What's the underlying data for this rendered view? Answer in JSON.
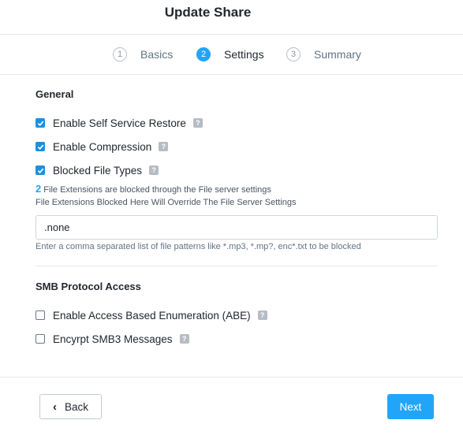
{
  "dialog": {
    "title": "Update Share"
  },
  "steps": [
    {
      "number": "1",
      "label": "Basics",
      "active": false
    },
    {
      "number": "2",
      "label": "Settings",
      "active": true
    },
    {
      "number": "3",
      "label": "Summary",
      "active": false
    }
  ],
  "general": {
    "title": "General",
    "self_service_restore": {
      "label": "Enable Self Service Restore",
      "checked": true
    },
    "compression": {
      "label": "Enable Compression",
      "checked": true
    },
    "blocked_file_types": {
      "label": "Blocked File Types",
      "checked": true
    },
    "blocked_count": "2",
    "blocked_info": "File Extensions are blocked through the File server settings",
    "override_note": "File Extensions Blocked Here Will Override The File Server Settings",
    "patterns_value": ".none",
    "patterns_hint": "Enter a comma separated list of file patterns like *.mp3, *.mp?, enc*.txt to be blocked"
  },
  "smb": {
    "title": "SMB Protocol Access",
    "abe": {
      "label": "Enable Access Based Enumeration (ABE)",
      "checked": false
    },
    "smb3_encrypt": {
      "label": "Encyrpt SMB3 Messages",
      "checked": false
    }
  },
  "help_glyph": "?",
  "check_glyph": "✓",
  "footer": {
    "back_label": "Back",
    "back_icon": "‹",
    "next_label": "Next"
  },
  "colors": {
    "accent": "#22a5f7",
    "checkbox": "#1a90e0"
  }
}
